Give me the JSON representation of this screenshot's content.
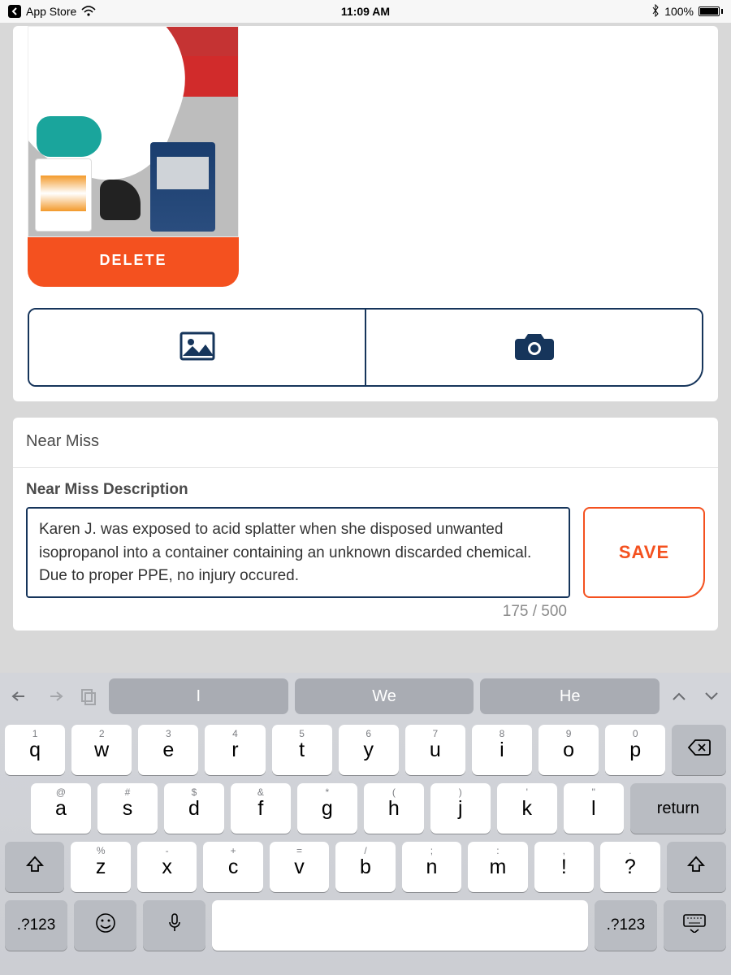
{
  "status": {
    "app_label": "App Store",
    "time": "11:09 AM",
    "battery_pct": "100%"
  },
  "photo_section": {
    "delete_label": "DELETE"
  },
  "nearmiss": {
    "section_title": "Near Miss",
    "description_label": "Near Miss Description",
    "description_value": "Karen J. was exposed to acid splatter when she disposed unwanted isopropanol into a container containing an unknown discarded chemical. Due to proper PPE, no injury occured.",
    "counter": "175 / 500",
    "save_label": "SAVE"
  },
  "keyboard": {
    "suggestions": [
      "I",
      "We",
      "He"
    ],
    "row1": [
      {
        "main": "q",
        "hint": "1"
      },
      {
        "main": "w",
        "hint": "2"
      },
      {
        "main": "e",
        "hint": "3"
      },
      {
        "main": "r",
        "hint": "4"
      },
      {
        "main": "t",
        "hint": "5"
      },
      {
        "main": "y",
        "hint": "6"
      },
      {
        "main": "u",
        "hint": "7"
      },
      {
        "main": "i",
        "hint": "8"
      },
      {
        "main": "o",
        "hint": "9"
      },
      {
        "main": "p",
        "hint": "0"
      }
    ],
    "row2": [
      {
        "main": "a",
        "hint": "@"
      },
      {
        "main": "s",
        "hint": "#"
      },
      {
        "main": "d",
        "hint": "$"
      },
      {
        "main": "f",
        "hint": "&"
      },
      {
        "main": "g",
        "hint": "*"
      },
      {
        "main": "h",
        "hint": "("
      },
      {
        "main": "j",
        "hint": ")"
      },
      {
        "main": "k",
        "hint": "'"
      },
      {
        "main": "l",
        "hint": "\""
      }
    ],
    "row3": [
      {
        "main": "z",
        "hint": "%"
      },
      {
        "main": "x",
        "hint": "-"
      },
      {
        "main": "c",
        "hint": "+"
      },
      {
        "main": "v",
        "hint": "="
      },
      {
        "main": "b",
        "hint": "/"
      },
      {
        "main": "n",
        "hint": ";"
      },
      {
        "main": "m",
        "hint": ":"
      },
      {
        "main": "!",
        "hint": ","
      },
      {
        "main": "?",
        "hint": "."
      }
    ],
    "numkey": ".?123",
    "return": "return"
  }
}
